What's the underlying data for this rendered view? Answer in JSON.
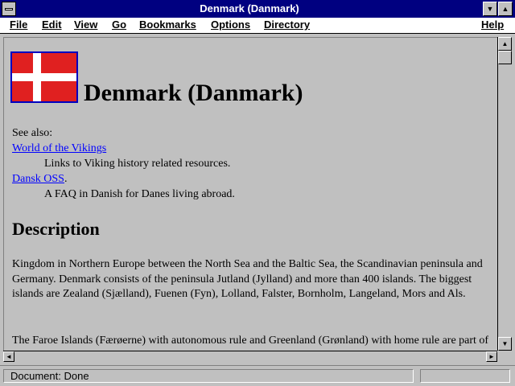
{
  "window": {
    "title": "Denmark (Danmark)",
    "controls": {
      "minimize_icon": "triangle-down",
      "maximize_icon": "triangle-up"
    }
  },
  "menu": {
    "items": [
      "File",
      "Edit",
      "View",
      "Go",
      "Bookmarks",
      "Options",
      "Directory"
    ],
    "help": "Help"
  },
  "page": {
    "heading": "Denmark (Danmark)",
    "see_also": "See also:",
    "links": [
      {
        "text": "World of the Vikings",
        "description": "Links to Viking history related resources."
      },
      {
        "text": "Dansk OSS",
        "suffix": ".",
        "description": "A FAQ in Danish for Danes living abroad."
      }
    ],
    "section_heading": "Description",
    "paragraphs": [
      "Kingdom in Northern Europe between the North Sea and the Baltic Sea, the Scandinavian peninsula and Germany. Denmark consists of the peninsula Jutland (Jylland) and more than 400 islands. The biggest islands are Zealand (Sjælland), Fuenen (Fyn), Lolland, Falster, Bornholm, Langeland, Mors and Als.",
      "The Faroe Islands (Færøerne) with autonomous rule and Greenland (Grønland) with home rule are part of the Danish Kingdom."
    ],
    "flag_colors": {
      "red": "#e02020",
      "white": "#ffffff",
      "border": "#0000c0"
    }
  },
  "status": {
    "text": "Document: Done"
  },
  "colors": {
    "titlebar": "#000080",
    "link": "#0000ff",
    "chrome": "#c0c0c0"
  }
}
